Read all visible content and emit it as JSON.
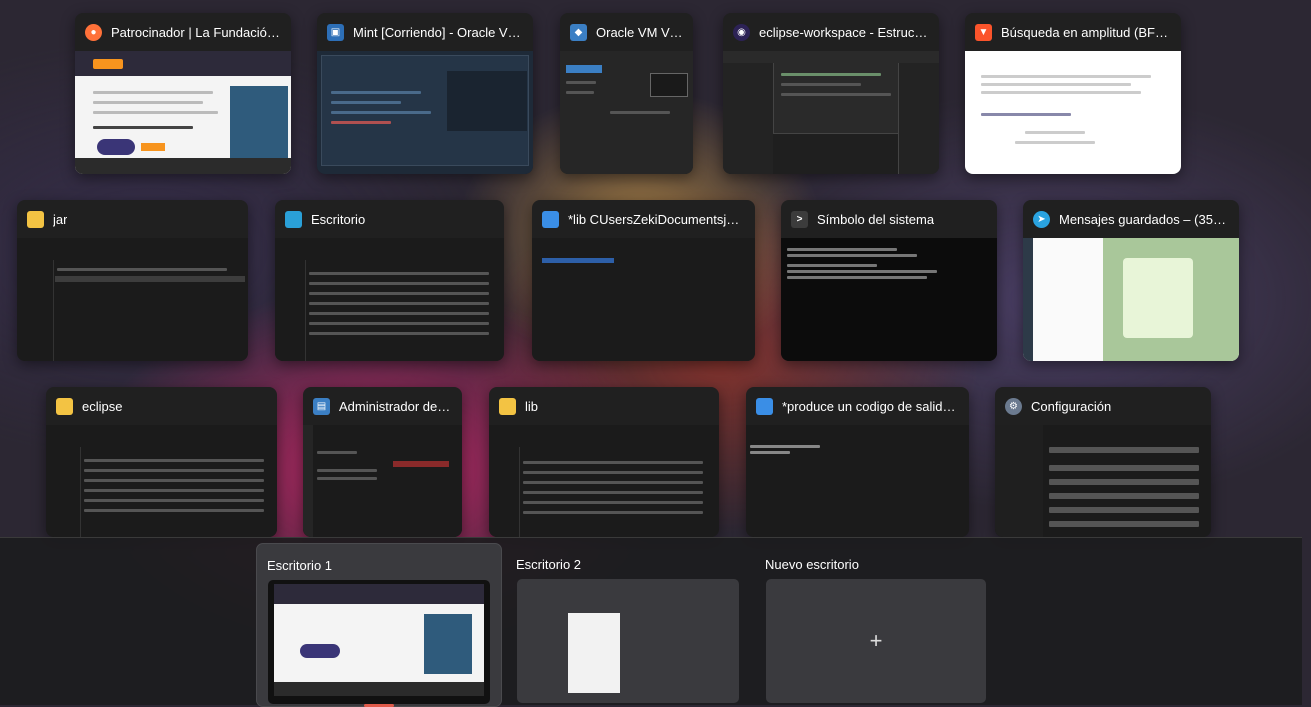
{
  "windows_row1": [
    {
      "title": "Patrocinador | La Fundación E...",
      "icon": "firefox-icon",
      "color": "#ff7139"
    },
    {
      "title": "Mint [Corriendo] - Oracle VM...",
      "icon": "virtualbox-icon",
      "color": "#2d6fb7"
    },
    {
      "title": "Oracle VM Virt...",
      "icon": "virtualbox-cube-icon",
      "color": "#3b7fc4"
    },
    {
      "title": "eclipse-workspace - Estructur...",
      "icon": "eclipse-icon",
      "color": "#2c2255"
    },
    {
      "title": "Búsqueda en amplitud (BFS): i...",
      "icon": "brave-icon",
      "color": "#fb542b"
    }
  ],
  "windows_row2": [
    {
      "title": "jar",
      "icon": "folder-icon",
      "color": "#f3c343"
    },
    {
      "title": "Escritorio",
      "icon": "desktop-icon",
      "color": "#2aa0d8"
    },
    {
      "title": "*lib CUsersZekiDocumentsjavaf...",
      "icon": "notepad-icon",
      "color": "#3a8ee6"
    },
    {
      "title": "Símbolo del sistema",
      "icon": "terminal-icon",
      "color": "#3c3c3c"
    },
    {
      "title": "Mensajes guardados – (35257)",
      "icon": "telegram-icon",
      "color": "#2aa3e0"
    }
  ],
  "windows_row3": [
    {
      "title": "eclipse",
      "icon": "folder-icon",
      "color": "#f3c343"
    },
    {
      "title": "Administrador de t...",
      "icon": "task-manager-icon",
      "color": "#3b7fc4"
    },
    {
      "title": "lib",
      "icon": "folder-icon",
      "color": "#f3c343"
    },
    {
      "title": "*produce un codigo de salida:...",
      "icon": "notepad-icon",
      "color": "#3a8ee6"
    },
    {
      "title": "Configuración",
      "icon": "gear-icon",
      "color": "#6b7a8f"
    }
  ],
  "desktops": [
    {
      "label": "Escritorio 1"
    },
    {
      "label": "Escritorio 2"
    },
    {
      "label": "Nuevo escritorio"
    }
  ],
  "new_desktop_plus": "+"
}
